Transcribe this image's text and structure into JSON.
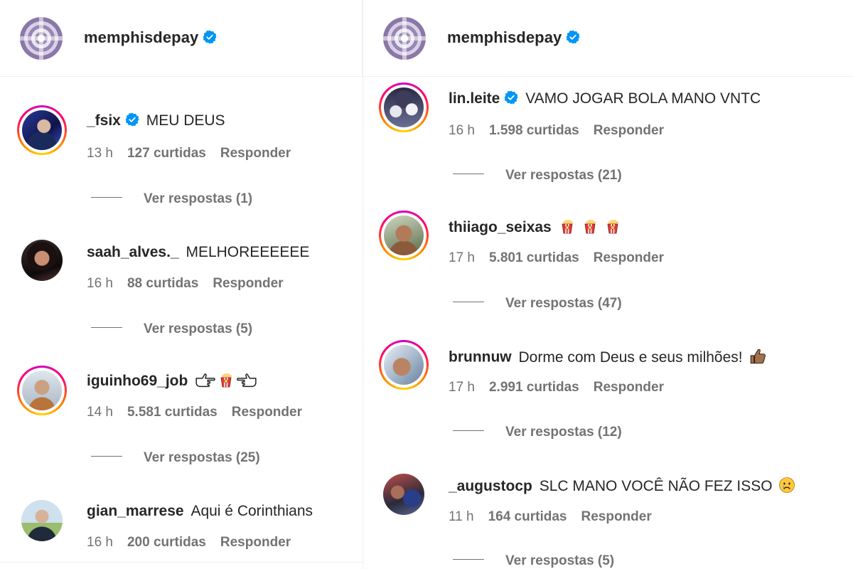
{
  "left": {
    "header": {
      "username": "memphisdepay"
    },
    "comments": [
      {
        "username": "_fsix",
        "verified": true,
        "text": "MEU DEUS",
        "time": "13 h",
        "likes": "127 curtidas",
        "reply_label": "Responder",
        "view_replies": "Ver respostas (1)"
      },
      {
        "username": "saah_alves._",
        "text": "MELHOREEEEEE",
        "time": "16 h",
        "likes": "88 curtidas",
        "reply_label": "Responder",
        "view_replies": "Ver respostas (5)"
      },
      {
        "username": "iguinho69_job",
        "text": "",
        "emojis": [
          "pointing-right-hand",
          "popcorn",
          "pointing-left-hand"
        ],
        "time": "14 h",
        "likes": "5.581 curtidas",
        "reply_label": "Responder",
        "view_replies": "Ver respostas (25)"
      },
      {
        "username": "gian_marrese",
        "text": "Aqui é Corinthians",
        "time": "16 h",
        "likes": "200 curtidas",
        "reply_label": "Responder"
      }
    ]
  },
  "right": {
    "header": {
      "username": "memphisdepay"
    },
    "comments": [
      {
        "username": "lin.leite",
        "verified": true,
        "text": "VAMO JOGAR BOLA MANO VNTC",
        "time": "16 h",
        "likes": "1.598 curtidas",
        "reply_label": "Responder",
        "view_replies": "Ver respostas (21)"
      },
      {
        "username": "thiiago_seixas",
        "text": "",
        "emojis": [
          "popcorn",
          "popcorn",
          "popcorn"
        ],
        "time": "17 h",
        "likes": "5.801 curtidas",
        "reply_label": "Responder",
        "view_replies": "Ver respostas (47)"
      },
      {
        "username": "brunnuw",
        "text": "Dorme com Deus e seus milhões!",
        "emojis": [
          "thumbs-up"
        ],
        "time": "17 h",
        "likes": "2.991 curtidas",
        "reply_label": "Responder",
        "view_replies": "Ver respostas (12)"
      },
      {
        "username": "_augustocp",
        "text": "SLC MANO VOCÊ NÃO FEZ ISSO",
        "emojis": [
          "sad-face"
        ],
        "time": "11 h",
        "likes": "164 curtidas",
        "reply_label": "Responder",
        "view_replies": "Ver respostas (5)"
      }
    ]
  },
  "colors": {
    "text": "#262626",
    "secondary": "#737373",
    "verified": "#0095f6",
    "divider": "#efefef"
  },
  "icons": [
    "verified-badge-icon"
  ]
}
